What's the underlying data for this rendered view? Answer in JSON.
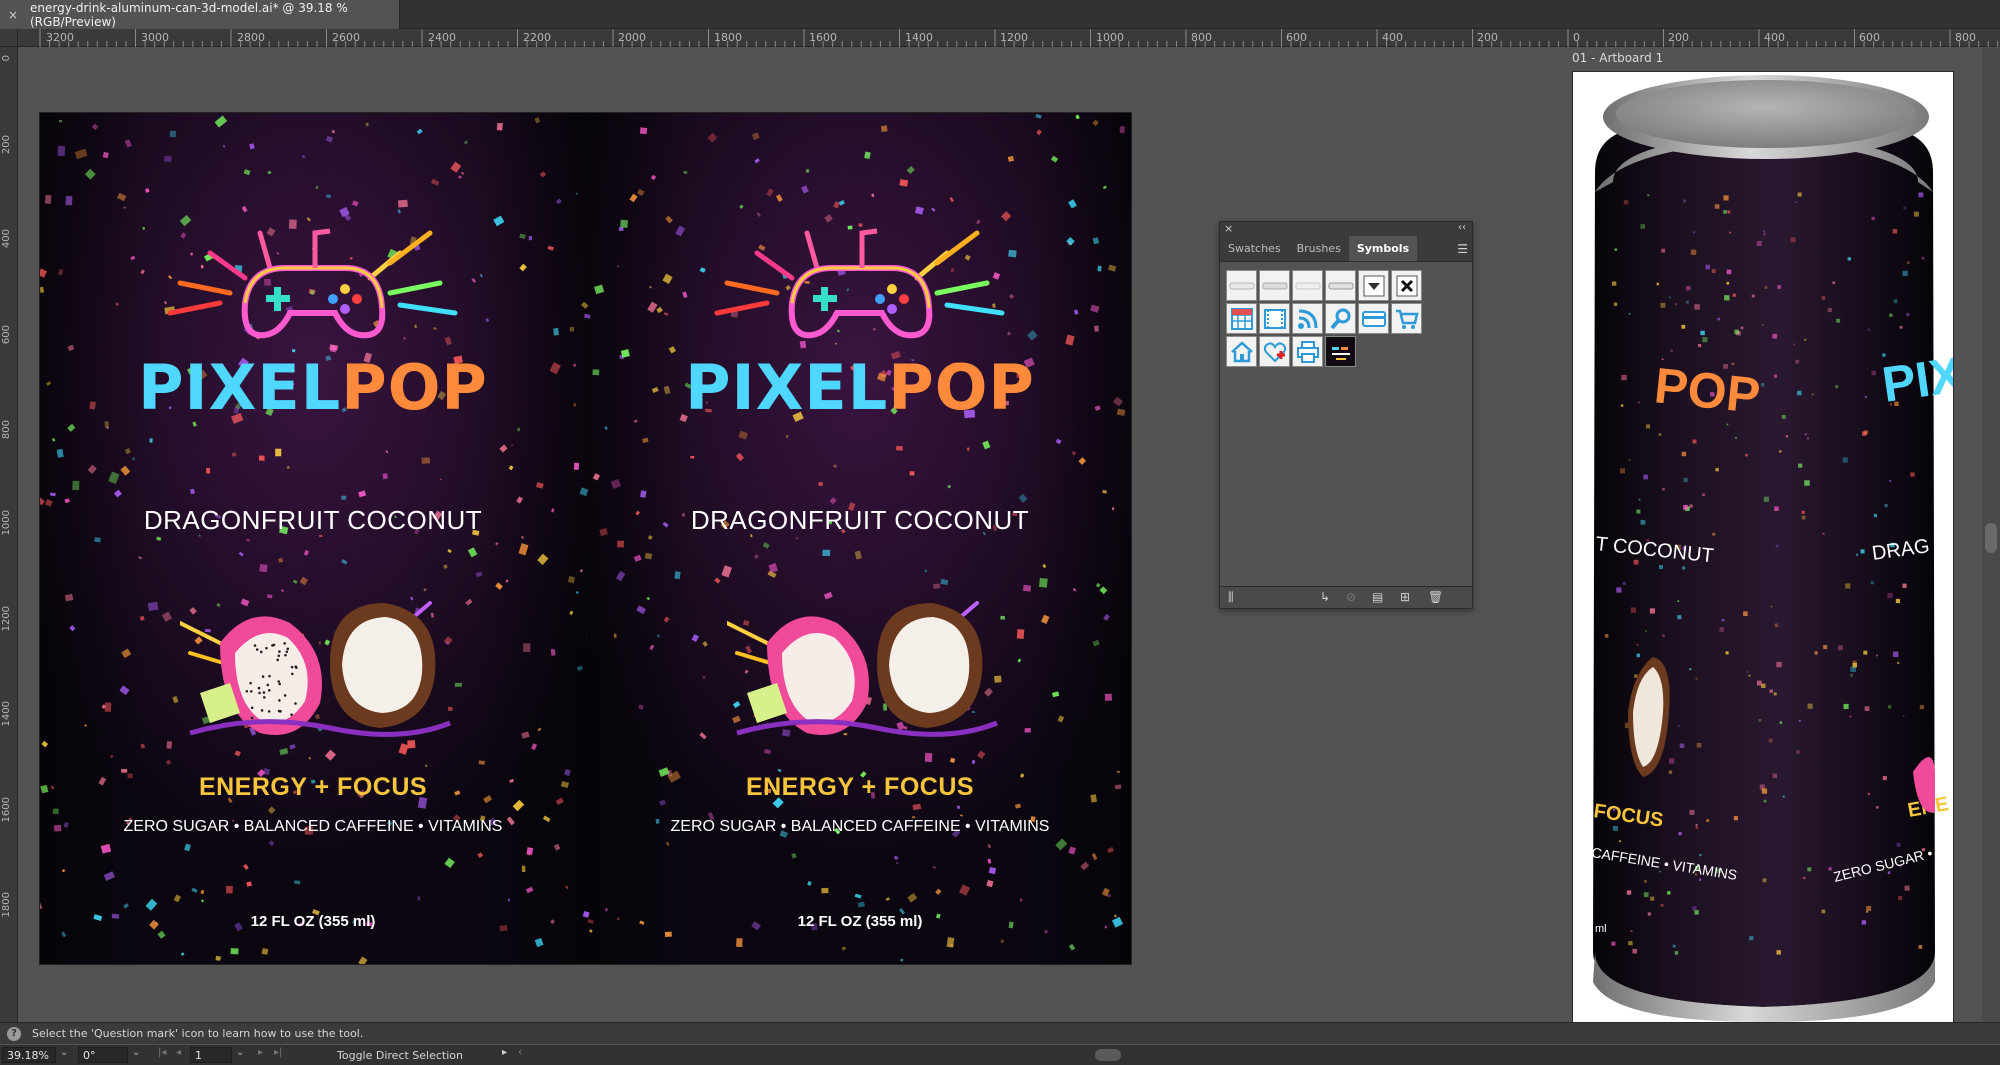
{
  "document": {
    "tab_title": "energy-drink-aluminum-can-3d-model.ai* @ 39.18 % (RGB/Preview)",
    "artboard_label": "01 - Artboard 1"
  },
  "ruler": {
    "horizontal_left": [
      "3200",
      "3000",
      "2800",
      "2600",
      "2400",
      "2200",
      "2000",
      "1800",
      "1600",
      "1400",
      "1200",
      "1000",
      "800",
      "600",
      "400",
      "200"
    ],
    "horizontal_right": [
      "0",
      "200",
      "400",
      "600",
      "800"
    ],
    "vertical": [
      "0",
      "200",
      "400",
      "600",
      "800",
      "1000",
      "1200",
      "1400",
      "1600",
      "1800"
    ]
  },
  "label": {
    "brand_part1": "PIXEL",
    "brand_part2": "POP",
    "flavor": "DRAGONFRUIT COCONUT",
    "tagline": "ENERGY + FOCUS",
    "claims": "ZERO SUGAR • BALANCED CAFFEINE • VITAMINS",
    "volume": "12 FL OZ (355 ml)"
  },
  "can_preview": {
    "brand_fragment_1": "POP",
    "brand_fragment_2": "PIX",
    "flavor_fragment_1": "T COCONUT",
    "flavor_fragment_2": "DRAG",
    "tag_fragment_1": "FOCUS",
    "tag_fragment_2": "ENE",
    "claims_fragment_1": "CAFFEINE • VITAMINS",
    "claims_fragment_2": "ZERO SUGAR • B",
    "volume_fragment": "ml"
  },
  "symbols_panel": {
    "tabs": [
      "Swatches",
      "Brushes",
      "Symbols"
    ],
    "active_tab": "Symbols",
    "symbols": [
      "button-1-symbol",
      "button-2-symbol",
      "button-3-symbol",
      "button-4-symbol",
      "dropdown-arrow-symbol",
      "close-x-symbol",
      "grid-table-symbol",
      "film-strip-symbol",
      "rss-feed-symbol",
      "magnifier-symbol",
      "credit-card-symbol",
      "shopping-cart-symbol",
      "home-symbol",
      "heart-plus-symbol",
      "printer-symbol",
      "pixelpop-thumbnail-symbol"
    ]
  },
  "status": {
    "help_text": "Select the 'Question mark' icon to learn how to use the tool.",
    "zoom": "39.18%",
    "rotation": "0°",
    "artboard_number": "1",
    "tool_hint": "Toggle Direct Selection"
  },
  "colors": {
    "canvas_bg": "#535353",
    "label_bg": "#0d0710",
    "brand_cyan": "#4fd7ff",
    "brand_orange": "#ff8a3c",
    "tagline_yellow": "#f7c53c",
    "symbol_blue": "#2d9bd8"
  }
}
